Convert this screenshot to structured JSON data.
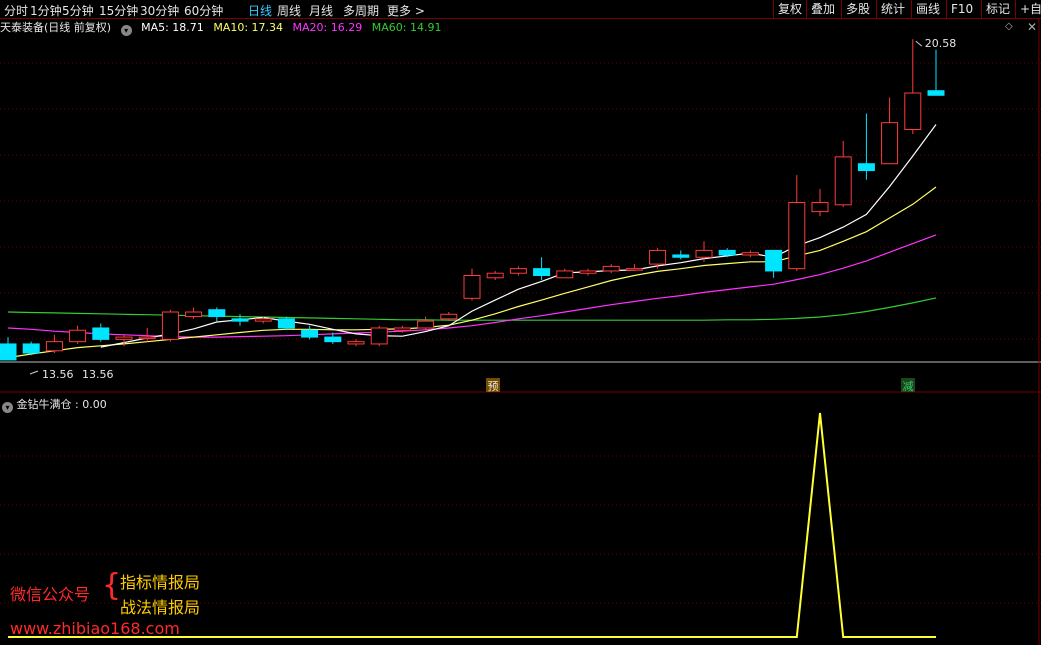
{
  "toolbar": {
    "periods": [
      "分时",
      "1分钟",
      "5分钟",
      "15分钟",
      "30分钟",
      "60分钟",
      "日线",
      "周线",
      "月线",
      "多周期",
      "更多 >"
    ],
    "active_index": 6,
    "right_buttons": [
      "复权",
      "叠加",
      "多股",
      "统计",
      "画线",
      "F10",
      "标记",
      "+自"
    ]
  },
  "header": {
    "stock": "天泰装备(日线 前复权)",
    "ma5": "MA5: 18.71",
    "ma10": "MA10: 17.34",
    "ma20": "MA20: 16.29",
    "ma60": "MA60: 14.91",
    "colors": {
      "ma5": "#ffffff",
      "ma10": "#ffff66",
      "ma20": "#ff33ff",
      "ma60": "#33cc33"
    }
  },
  "indicator": {
    "label": "金钻牛满仓",
    "value": ": 0.00",
    "line_color": "#ffff33"
  },
  "chart_labels": {
    "high": "20.58",
    "low": "13.56",
    "low_dup": "13.56",
    "marker_yu": "预",
    "marker_jian": "减"
  },
  "watermark": {
    "left": "微信公众号",
    "line1": "指标情报局",
    "line2": "战法情报局",
    "url": "www.zhibiao168.com"
  },
  "chart_data": {
    "type": "candlestick",
    "up_color": "#ff3b3b",
    "down_color": "#00e5ff",
    "price_range": [
      13.0,
      21.0
    ],
    "candles": [
      [
        13.9,
        13.55,
        14.05,
        13.55
      ],
      [
        13.9,
        13.7,
        13.95,
        13.65
      ],
      [
        13.75,
        13.95,
        14.1,
        13.7
      ],
      [
        13.95,
        14.2,
        14.3,
        13.9
      ],
      [
        14.25,
        14.0,
        14.35,
        13.95
      ],
      [
        14.0,
        14.05,
        14.1,
        13.85
      ],
      [
        14.05,
        14.05,
        14.25,
        13.95
      ],
      [
        14.0,
        14.6,
        14.65,
        13.95
      ],
      [
        14.5,
        14.6,
        14.7,
        14.45
      ],
      [
        14.65,
        14.5,
        14.7,
        14.4
      ],
      [
        14.45,
        14.4,
        14.55,
        14.3
      ],
      [
        14.4,
        14.45,
        14.5,
        14.35
      ],
      [
        14.45,
        14.25,
        14.5,
        14.2
      ],
      [
        14.2,
        14.05,
        14.3,
        14.0
      ],
      [
        14.05,
        13.95,
        14.15,
        13.9
      ],
      [
        13.9,
        13.95,
        14.0,
        13.85
      ],
      [
        13.9,
        14.25,
        14.3,
        13.85
      ],
      [
        14.2,
        14.25,
        14.3,
        14.15
      ],
      [
        14.25,
        14.4,
        14.5,
        14.2
      ],
      [
        14.45,
        14.55,
        14.6,
        14.4
      ],
      [
        14.9,
        15.4,
        15.55,
        14.85
      ],
      [
        15.35,
        15.45,
        15.5,
        15.3
      ],
      [
        15.45,
        15.55,
        15.6,
        15.4
      ],
      [
        15.55,
        15.4,
        15.8,
        15.3
      ],
      [
        15.35,
        15.5,
        15.55,
        15.35
      ],
      [
        15.45,
        15.5,
        15.55,
        15.4
      ],
      [
        15.5,
        15.6,
        15.65,
        15.45
      ],
      [
        15.55,
        15.55,
        15.65,
        15.5
      ],
      [
        15.65,
        15.95,
        16.0,
        15.55
      ],
      [
        15.85,
        15.8,
        15.95,
        15.75
      ],
      [
        15.8,
        15.95,
        16.15,
        15.7
      ],
      [
        15.95,
        15.85,
        16.0,
        15.8
      ],
      [
        15.85,
        15.9,
        15.95,
        15.8
      ],
      [
        15.95,
        15.5,
        15.95,
        15.35
      ],
      [
        15.55,
        17.0,
        17.6,
        15.5
      ],
      [
        16.8,
        17.0,
        17.3,
        16.7
      ],
      [
        16.95,
        18.0,
        18.35,
        16.9
      ],
      [
        17.85,
        17.7,
        18.95,
        17.5
      ],
      [
        17.85,
        18.75,
        19.3,
        17.85
      ],
      [
        18.6,
        19.4,
        20.58,
        18.5
      ],
      [
        19.45,
        19.35,
        20.35,
        19.35
      ]
    ],
    "ma5": [
      null,
      null,
      null,
      null,
      13.83,
      13.93,
      14.03,
      14.12,
      14.23,
      14.38,
      14.43,
      14.48,
      14.4,
      14.33,
      14.22,
      14.12,
      14.08,
      14.07,
      14.17,
      14.3,
      14.62,
      14.86,
      15.1,
      15.27,
      15.46,
      15.48,
      15.51,
      15.52,
      15.61,
      15.68,
      15.77,
      15.83,
      15.89,
      15.8,
      16.05,
      16.23,
      16.46,
      16.74,
      17.35,
      18.02,
      18.71
    ],
    "ma10": [
      13.6,
      13.68,
      13.75,
      13.82,
      13.86,
      13.9,
      13.95,
      14.0,
      14.05,
      14.1,
      14.15,
      14.2,
      14.22,
      14.22,
      14.21,
      14.21,
      14.22,
      14.23,
      14.26,
      14.31,
      14.42,
      14.56,
      14.72,
      14.86,
      15.01,
      15.15,
      15.29,
      15.4,
      15.49,
      15.55,
      15.62,
      15.66,
      15.7,
      15.7,
      15.83,
      15.95,
      16.15,
      16.36,
      16.66,
      16.96,
      17.34
    ],
    "ma20": [
      14.25,
      14.22,
      14.18,
      14.15,
      14.12,
      14.1,
      14.08,
      14.06,
      14.05,
      14.05,
      14.06,
      14.07,
      14.08,
      14.1,
      14.12,
      14.14,
      14.16,
      14.18,
      14.21,
      14.25,
      14.3,
      14.37,
      14.45,
      14.52,
      14.6,
      14.68,
      14.76,
      14.83,
      14.9,
      14.96,
      15.03,
      15.09,
      15.15,
      15.21,
      15.31,
      15.42,
      15.56,
      15.72,
      15.91,
      16.1,
      16.29
    ],
    "ma60": [
      14.6,
      14.59,
      14.58,
      14.57,
      14.56,
      14.55,
      14.54,
      14.53,
      14.52,
      14.51,
      14.5,
      14.49,
      14.48,
      14.47,
      14.46,
      14.45,
      14.44,
      14.43,
      14.43,
      14.42,
      14.42,
      14.42,
      14.42,
      14.42,
      14.42,
      14.42,
      14.42,
      14.42,
      14.42,
      14.42,
      14.42,
      14.43,
      14.43,
      14.44,
      14.46,
      14.49,
      14.54,
      14.61,
      14.7,
      14.8,
      14.91
    ],
    "indicator_values": [
      0,
      0,
      0,
      0,
      0,
      0,
      0,
      0,
      0,
      0,
      0,
      0,
      0,
      0,
      0,
      0,
      0,
      0,
      0,
      0,
      0,
      0,
      0,
      0,
      0,
      0,
      0,
      0,
      0,
      0,
      0,
      0,
      0,
      0,
      0,
      1,
      0,
      0,
      0,
      0,
      0
    ],
    "indicator_range": [
      0,
      1
    ]
  }
}
